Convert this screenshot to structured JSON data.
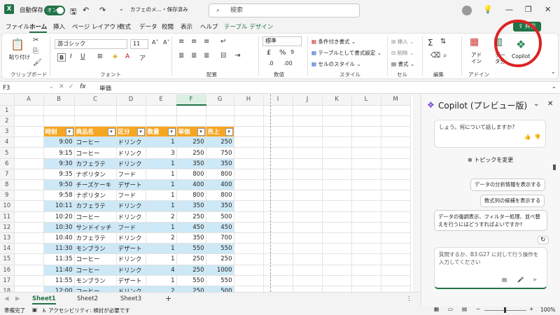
{
  "titlebar": {
    "autosave_label": "自動保存",
    "autosave_state": "オン",
    "filename": "カフェのメ…・保存済み",
    "search_placeholder": "検索"
  },
  "tabs": [
    "ファイル",
    "ホーム",
    "挿入",
    "ページ レイアウト",
    "数式",
    "データ",
    "校閲",
    "表示",
    "ヘルプ",
    "テーブル デザイン"
  ],
  "share_label": "共有",
  "ribbon": {
    "clipboard": {
      "paste": "貼り付け",
      "label": "クリップボード"
    },
    "font": {
      "name": "游ゴシック",
      "size": "11",
      "label": "フォント"
    },
    "alignment": {
      "label": "配置"
    },
    "number": {
      "format": "標準",
      "label": "数値"
    },
    "styles": {
      "conditional": "条件付き書式",
      "table": "テーブルとして書式設定",
      "cell": "セルのスタイル",
      "label": "スタイル"
    },
    "cells": {
      "insert": "挿入",
      "delete": "削除",
      "format": "書式",
      "label": "セル"
    },
    "editing": {
      "label": "編集"
    },
    "addins": {
      "addin": "アド\nイン",
      "data": "デー\nタ分",
      "label": "アドイン"
    },
    "copilot": "Copilot"
  },
  "formula_bar": {
    "cell": "F3",
    "value": "単価"
  },
  "columns": [
    "A",
    "B",
    "C",
    "D",
    "E",
    "F",
    "G",
    "H",
    "I",
    "J",
    "K",
    "L",
    "M"
  ],
  "table": {
    "headers": [
      "時刻",
      "商品名",
      "区分",
      "数量",
      "単価",
      "売上"
    ],
    "rows": [
      [
        "9:00",
        "コーヒー",
        "ドリンク",
        "1",
        "250",
        "250"
      ],
      [
        "9:15",
        "コーヒー",
        "ドリンク",
        "3",
        "250",
        "750"
      ],
      [
        "9:30",
        "カフェラテ",
        "ドリンク",
        "1",
        "350",
        "350"
      ],
      [
        "9:35",
        "ナポリタン",
        "フード",
        "1",
        "800",
        "800"
      ],
      [
        "9:50",
        "チーズケーキ",
        "デザート",
        "1",
        "400",
        "400"
      ],
      [
        "9:58",
        "ナポリタン",
        "フード",
        "1",
        "800",
        "800"
      ],
      [
        "10:11",
        "カフェラテ",
        "ドリンク",
        "1",
        "350",
        "350"
      ],
      [
        "10:20",
        "コーヒー",
        "ドリンク",
        "2",
        "250",
        "500"
      ],
      [
        "10:30",
        "サンドイッチ",
        "フード",
        "1",
        "450",
        "450"
      ],
      [
        "10:40",
        "カフェラテ",
        "ドリンク",
        "2",
        "350",
        "700"
      ],
      [
        "11:30",
        "モンブラン",
        "デザート",
        "1",
        "550",
        "550"
      ],
      [
        "11:35",
        "コーヒー",
        "ドリンク",
        "1",
        "250",
        "250"
      ],
      [
        "11:40",
        "コーヒー",
        "ドリンク",
        "4",
        "250",
        "1000"
      ],
      [
        "11:55",
        "モンブラン",
        "デザート",
        "1",
        "550",
        "550"
      ],
      [
        "12:00",
        "コーヒー",
        "ドリンク",
        "2",
        "250",
        "500"
      ]
    ]
  },
  "sheets": [
    "Sheet1",
    "Sheet2",
    "Sheet3"
  ],
  "status": {
    "ready": "準備完了",
    "accessibility": "アクセシビリティ: 検討が必要です",
    "zoom": "100%"
  },
  "copilot": {
    "title": "Copilot (プレビュー版)",
    "message_tail": "しょう。何について話しますか?",
    "change_topic": "トピックを変更",
    "suggestions": [
      "データの分析情報を表示する",
      "数式列の候補を表示する"
    ],
    "long_suggestion": "データの強調表示、フィルター処理、並べ替えを行うにはどうすればよいですか?",
    "input_placeholder": "質問するか、B3:G27 に対して行う操作を入力してください"
  }
}
